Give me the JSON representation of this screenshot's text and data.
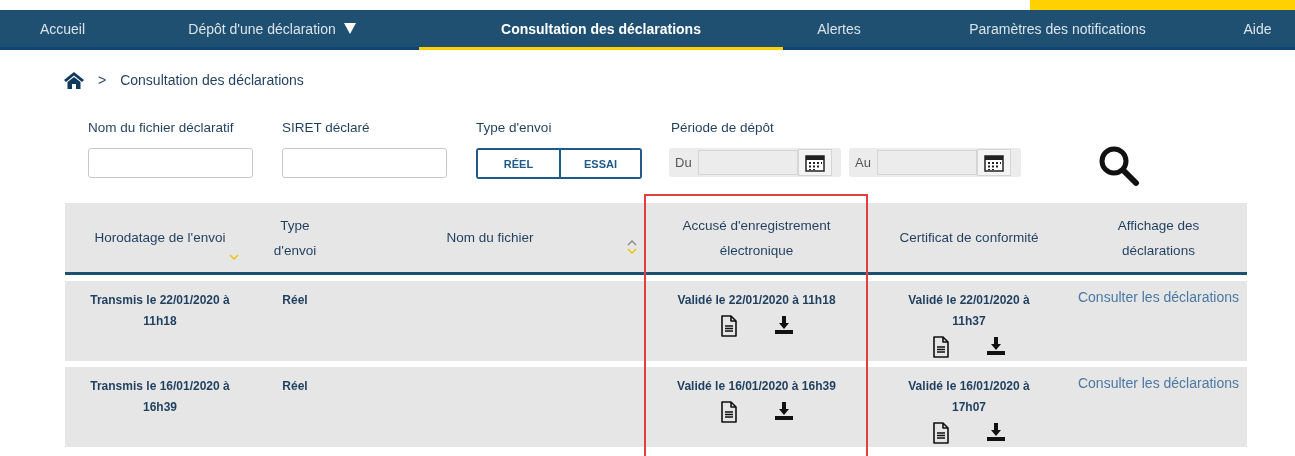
{
  "nav": [
    {
      "label": "Accueil",
      "selected": false,
      "has_menu": false
    },
    {
      "label": "Dépôt d'une déclaration",
      "selected": false,
      "has_menu": true
    },
    {
      "label": "Consultation des déclarations",
      "selected": true,
      "has_menu": false
    },
    {
      "label": "Alertes",
      "selected": false,
      "has_menu": false
    },
    {
      "label": "Paramètres des notifications",
      "selected": false,
      "has_menu": false
    },
    {
      "label": "Aide",
      "selected": false,
      "has_menu": false
    }
  ],
  "breadcrumb": {
    "separator": ">",
    "current": "Consultation des déclarations"
  },
  "filters": {
    "fields": [
      {
        "label": "Nom du fichier déclaratif"
      },
      {
        "label": "SIRET déclaré"
      }
    ],
    "send_type": {
      "label": "Type d'envoi",
      "options": [
        {
          "label": "RÉEL",
          "selected": false
        },
        {
          "label": "ESSAI",
          "selected": false
        }
      ]
    },
    "period": {
      "label": "Période de dépôt",
      "from": "Du",
      "to": "Au"
    }
  },
  "table": {
    "columns": [
      {
        "label": "Horodatage de l'envoi",
        "sort_up": false,
        "sort_down": true,
        "highlighted": false
      },
      {
        "label": "Type d'envoi",
        "sort_up": false,
        "sort_down": false,
        "highlighted": false
      },
      {
        "label": "Nom du fichier",
        "sort_up": true,
        "sort_down": true,
        "highlighted": false
      },
      {
        "label": "Accusé d'enregistrement électronique",
        "sort_up": false,
        "sort_down": false,
        "highlighted": true
      },
      {
        "label": "Certificat de conformité",
        "sort_up": false,
        "sort_down": false,
        "highlighted": false
      },
      {
        "label": "Affichage des déclarations",
        "sort_up": false,
        "sort_down": false,
        "highlighted": false
      }
    ],
    "rows": [
      {
        "sent": "Transmis le 22/01/2020 à 11h18",
        "type": "Réel",
        "receipt": "Validé le 22/01/2020 à 11h18",
        "certificate": "Validé le 22/01/2020 à 11h37",
        "link": "Consulter les déclarations"
      },
      {
        "sent": "Transmis le 16/01/2020 à 16h39",
        "type": "Réel",
        "receipt": "Validé le 16/01/2020 à 16h39",
        "certificate": "Validé le 16/01/2020 à 17h07",
        "link": "Consulter les déclarations"
      }
    ]
  }
}
